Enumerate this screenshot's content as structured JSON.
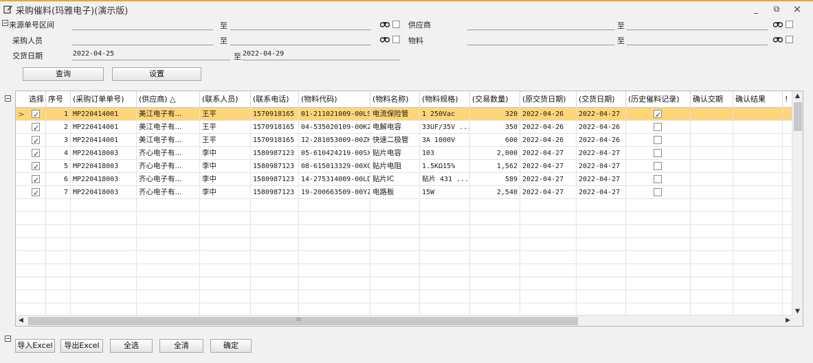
{
  "window": {
    "title": "采购催料(玛雅电子)(演示版)",
    "minimize": "_",
    "restore": "⧉",
    "close": "×"
  },
  "filters": {
    "source_no_label": "来源单号区间",
    "buyer_label": "采购人员",
    "delivery_date_label": "交货日期",
    "supplier_label": "供应商",
    "material_label": "物料",
    "to": "至",
    "date_from": "2022-04-25",
    "date_to": "2022-04-29"
  },
  "buttons": {
    "query": "查询",
    "settings": "设置",
    "import_excel": "导入Excel",
    "export_excel": "导出Excel",
    "select_all": "全选",
    "clear_all": "全清",
    "confirm": "确定"
  },
  "table": {
    "headers": [
      "选择",
      "序号",
      "(采购订单单号)",
      "(供应商) △",
      "(联系人员)",
      "(联系电话)",
      "(物料代码)",
      "(物料名称)",
      "(物料规格)",
      "(交易数量)",
      "(原交货日期)",
      "(交货日期)",
      "(历史催料记录)",
      "确认交期",
      "确认结果",
      "!"
    ],
    "rows": [
      {
        "checked": true,
        "seq": "1",
        "po": "MP220414001",
        "supplier": "美江电子有...",
        "contact": "王平",
        "phone": "1570918165",
        "code": "01-211021009-00LS",
        "name": "电流保险管",
        "spec": "1 250Vac",
        "qty": "320",
        "orig_date": "2022-04-26",
        "date": "2022-04-27",
        "history": true
      },
      {
        "checked": true,
        "seq": "2",
        "po": "MP220414001",
        "supplier": "美江电子有...",
        "contact": "王平",
        "phone": "1570918165",
        "code": "04-535020109-00KZ",
        "name": "电解电容",
        "spec": "33UF/35V ...",
        "qty": "350",
        "orig_date": "2022-04-26",
        "date": "2022-04-26",
        "history": false
      },
      {
        "checked": true,
        "seq": "3",
        "po": "MP220414001",
        "supplier": "美江电子有...",
        "contact": "王平",
        "phone": "1570918165",
        "code": "12-281053009-00ZH",
        "name": "快速二极管",
        "spec": "3A 1000V",
        "qty": "600",
        "orig_date": "2022-04-26",
        "date": "2022-04-26",
        "history": false
      },
      {
        "checked": true,
        "seq": "4",
        "po": "MP220418003",
        "supplier": "齐心电子有...",
        "contact": "李中",
        "phone": "1580987123",
        "code": "05-610424219-00SX",
        "name": "贴片电容",
        "spec": "103",
        "qty": "2,000",
        "orig_date": "2022-04-27",
        "date": "2022-04-27",
        "history": false
      },
      {
        "checked": true,
        "seq": "5",
        "po": "MP220418003",
        "supplier": "齐心电子有...",
        "contact": "李中",
        "phone": "1580987123",
        "code": "08-615013329-00XG",
        "name": "贴片电阻",
        "spec": "1.5KΩ15%",
        "qty": "1,562",
        "orig_date": "2022-04-27",
        "date": "2022-04-27",
        "history": false
      },
      {
        "checked": true,
        "seq": "6",
        "po": "MP220418003",
        "supplier": "齐心电子有...",
        "contact": "李中",
        "phone": "1580987123",
        "code": "14-275314009-00LD",
        "name": "贴片IC",
        "spec": "贴片 431 ...",
        "qty": "589",
        "orig_date": "2022-04-27",
        "date": "2022-04-27",
        "history": false
      },
      {
        "checked": true,
        "seq": "7",
        "po": "MP220418003",
        "supplier": "齐心电子有...",
        "contact": "李中",
        "phone": "1580987123",
        "code": "19-200663509-00YZ",
        "name": "电路板",
        "spec": "15W",
        "qty": "2,540",
        "orig_date": "2022-04-27",
        "date": "2022-04-27",
        "history": false
      }
    ],
    "row_indicator": ">",
    "hscroll_mid": "III"
  },
  "colors": {
    "selected_row": "#ffd57a",
    "title_accent": "#e9a825"
  },
  "icons": [
    "edit-icon",
    "binoculars-icon",
    "collapse-icon",
    "checkbox-icon"
  ]
}
